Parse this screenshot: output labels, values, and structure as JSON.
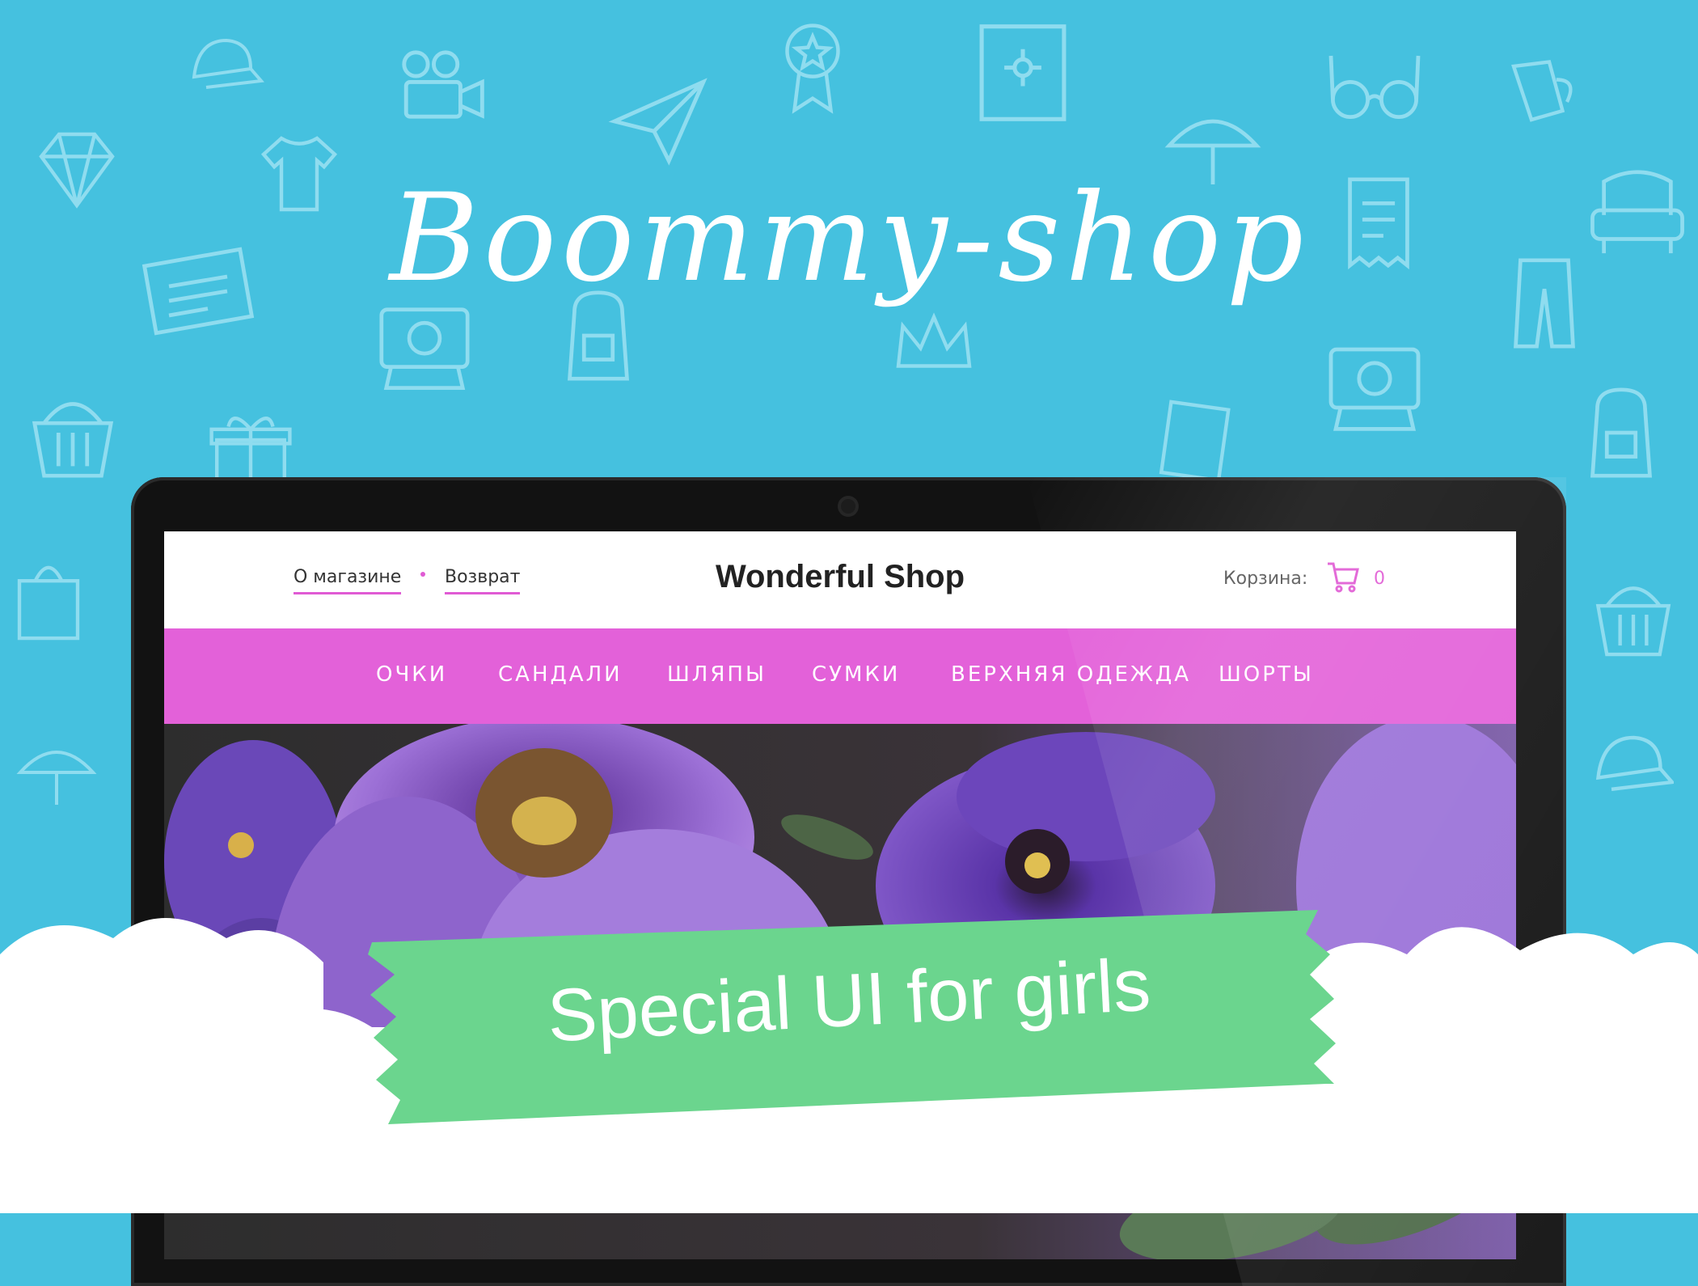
{
  "headline": "Boommy-shop",
  "shop": {
    "links": [
      "О магазине",
      "Возврат"
    ],
    "brand": "Wonderful Shop",
    "cart_label": "Корзина:",
    "cart_count": "0",
    "nav": [
      "ОЧКИ",
      "САНДАЛИ",
      "ШЛЯПЫ",
      "СУМКИ",
      "ВЕРХНЯЯ ОДЕЖДА",
      "ШОРТЫ"
    ]
  },
  "ribbon_text": "Special UI for girls",
  "colors": {
    "background": "#45c1df",
    "nav_pink": "#e361d9",
    "ribbon_green": "#6bd58e",
    "laptop_frame": "#121212",
    "flower_purple": "#8a59c7"
  },
  "icons": [
    "cap-icon",
    "camera-icon",
    "award-icon",
    "paper-plane-icon",
    "picture-icon",
    "glasses-icon",
    "mug-icon",
    "diamond-icon",
    "tshirt-icon",
    "umbrella-icon",
    "receipt-icon",
    "armchair-icon",
    "newspaper-icon",
    "backpack-icon",
    "polaroid-icon",
    "trousers-icon",
    "basket-icon",
    "gift-icon",
    "book-icon",
    "crown-icon",
    "cart-icon"
  ]
}
